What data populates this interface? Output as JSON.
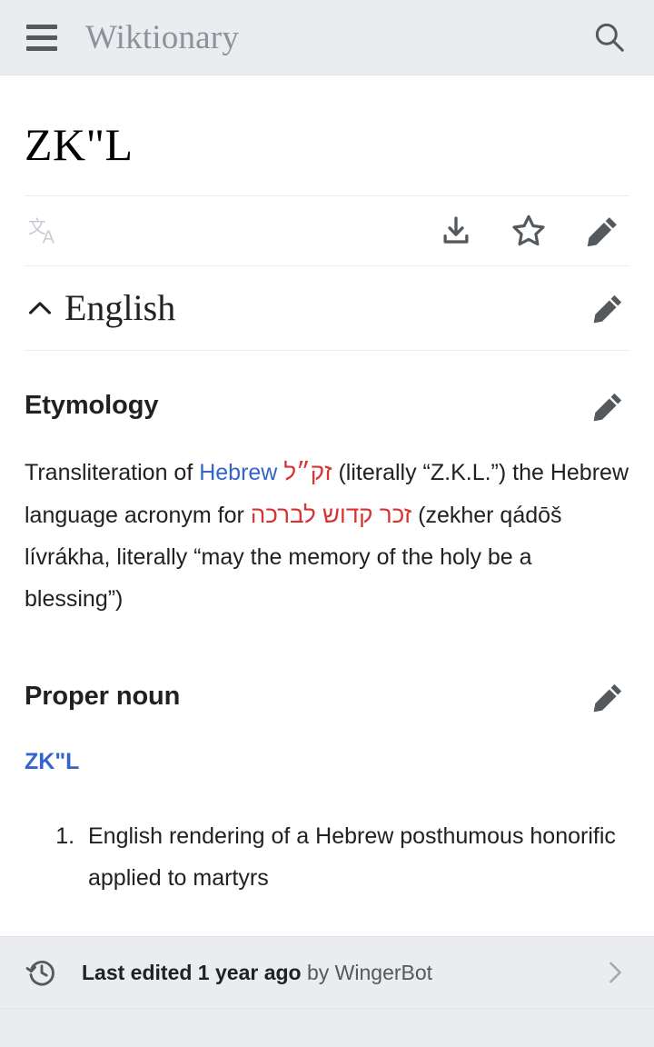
{
  "header": {
    "wordmark": "Wiktionary",
    "menu_icon": "hamburger-menu-icon",
    "search_icon": "search-icon"
  },
  "page": {
    "title": "ZK\"L"
  },
  "action_bar": {
    "language_icon": "language-icon",
    "language_glyph": "文A",
    "download_icon": "download-icon",
    "watch_icon": "star-outline-icon",
    "edit_icon": "edit-pencil-icon"
  },
  "language_section": {
    "collapse_icon": "chevron-up-icon",
    "title": "English",
    "edit_icon": "edit-pencil-icon"
  },
  "etymology": {
    "heading": "Etymology",
    "edit_icon": "edit-pencil-icon",
    "text_part1": "Transliteration of ",
    "link_hebrew": "Hebrew",
    "hebrew_term": "זק״ל",
    "text_part2": " (literally “Z.K.L.”) the Hebrew language acronym for ",
    "hebrew_phrase": "זכר קדוש לברכה",
    "text_part3": " (zekher qádōš lívrákha, literally “may the memory of the holy be a blessing”)"
  },
  "proper_noun": {
    "heading": "Proper noun",
    "edit_icon": "edit-pencil-icon",
    "headword": "ZK\"L",
    "definitions": [
      "English rendering of a Hebrew posthumous honorific applied to martyrs"
    ]
  },
  "footer": {
    "history_icon": "history-clock-icon",
    "last_edited_bold": "Last edited 1 year ago",
    "by_text": " by WingerBot",
    "chevron_icon": "chevron-right-icon"
  },
  "colors": {
    "chrome_bg": "#eaecf0",
    "content_bg": "#ffffff",
    "link_blue": "#3366cc",
    "redlink": "#d73333",
    "icon_gray": "#54595d",
    "wordmark_gray": "#8d9299"
  }
}
